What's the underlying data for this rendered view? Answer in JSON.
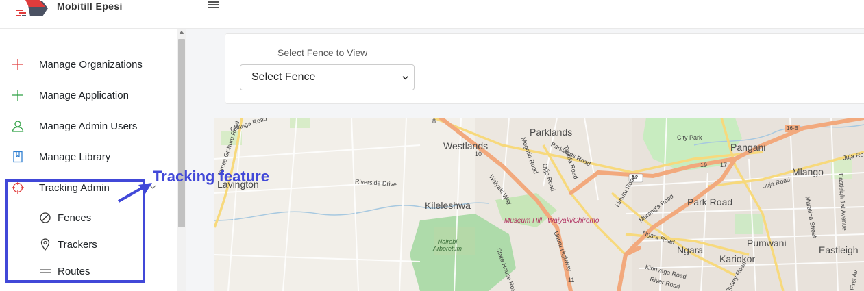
{
  "brand": {
    "name": "Mobitill Epesi"
  },
  "sidebar": {
    "items": [
      {
        "label": "Manage Organizations",
        "icon": "plus-icon",
        "color": "#e03c3c"
      },
      {
        "label": "Manage Application",
        "icon": "plus-icon",
        "color": "#2ea043"
      },
      {
        "label": "Manage Admin Users",
        "icon": "user-icon",
        "color": "#2ea043"
      },
      {
        "label": "Manage Library",
        "icon": "book-icon",
        "color": "#2f7fd1"
      },
      {
        "label": "Tracking Admin",
        "icon": "crosshair-icon",
        "color": "#e03c3c"
      }
    ],
    "subitems": [
      {
        "label": "Fences",
        "icon": "prohibited-circle-icon"
      },
      {
        "label": "Trackers",
        "icon": "map-pin-icon"
      },
      {
        "label": "Routes",
        "icon": "double-line-icon"
      }
    ]
  },
  "fence": {
    "label": "Select Fence to View",
    "select_value": "Select Fence"
  },
  "annotation": {
    "text": "Tracking feature",
    "color": "#4148d8"
  },
  "map": {
    "labels": {
      "parklands": "Parklands",
      "westlands": "Westlands",
      "city_park": "City Park",
      "pangani": "Pangani",
      "mlango": "Mlango",
      "park_road": "Park Road",
      "kileleshwa": "Kileleshwa",
      "lavington": "Lavington",
      "ngara": "Ngara",
      "kariokor": "Kariokor",
      "pumwani": "Pumwani",
      "eastleigh": "Eastleigh",
      "riverside": "Riverside Drive",
      "museum_hill": "Museum Hill",
      "waiyaki_chiromo": "Waiyaki/Chiromo",
      "arboretum": "Nairobi Arboretum",
      "a2": "A2",
      "b16": "16-B",
      "juja_road": "Juja Road",
      "juja_ro": "Juja Ro",
      "waiyaki_way": "Waiyaki Way",
      "parklands_road": "Parklands Road",
      "murang_road": "Murang'a Road",
      "ngara_road": "Ngara Road",
      "limuru_road": "Limuru Road",
      "uhuru_highway": "Uhuru Highway",
      "river_road": "River Road",
      "kirinyaga_road": "Kirinyaga Road",
      "state_house_road": "State House Road",
      "gitanga_road": "Gitanga Road",
      "gichururoad": "James Gichuru Road",
      "mogotio_road": "Mogotio Road",
      "ojijo_road": "Ojijo Road",
      "tsarifa_road": "Tsarifa Road",
      "quarry_road": "Quarry Road",
      "eastleigh_ave": "Eastleigh 1st Avenue",
      "muratina_street": "Muratina Street",
      "first_av": "First Av",
      "n10": "10",
      "n11": "11",
      "n19": "19",
      "n17": "17",
      "n8": "8"
    }
  }
}
